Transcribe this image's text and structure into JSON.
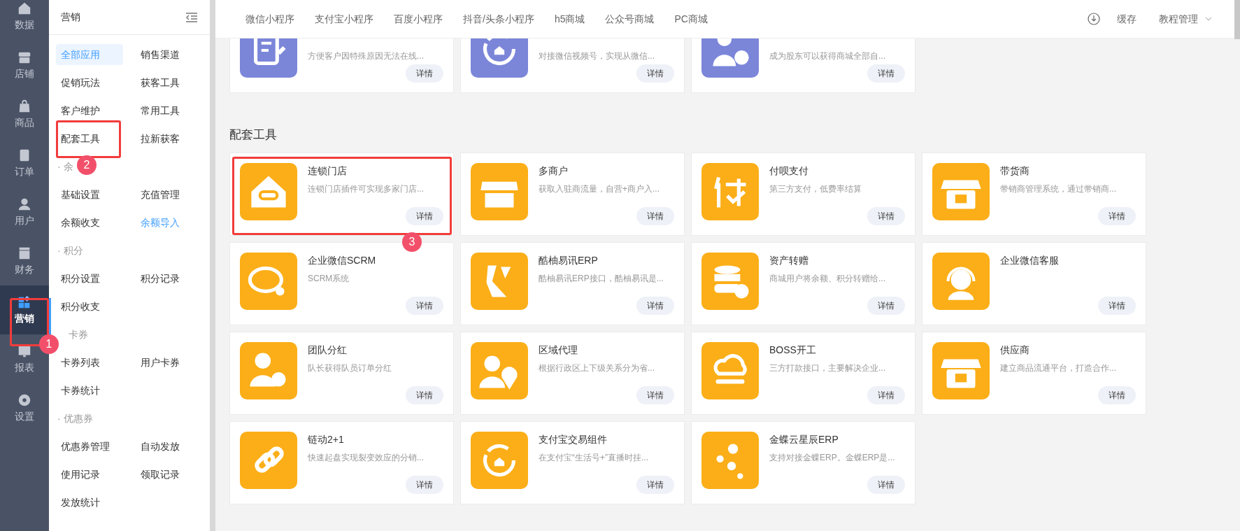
{
  "rail": [
    {
      "label": "数据",
      "selected": false
    },
    {
      "label": "店铺",
      "selected": false
    },
    {
      "label": "商品",
      "selected": false
    },
    {
      "label": "订单",
      "selected": false
    },
    {
      "label": "用户",
      "selected": false
    },
    {
      "label": "财务",
      "selected": false
    },
    {
      "label": "营销",
      "selected": true
    },
    {
      "label": "报表",
      "selected": false
    },
    {
      "label": "设置",
      "selected": false
    }
  ],
  "submenu": {
    "title": "营销",
    "groups": [
      {
        "items": [
          {
            "label": "全部应用",
            "kind": "normal",
            "selected": true
          },
          {
            "label": "销售渠道",
            "kind": "normal",
            "selected": false
          },
          {
            "label": "促销玩法",
            "kind": "normal",
            "selected": false
          },
          {
            "label": "获客工具",
            "kind": "normal",
            "selected": false
          },
          {
            "label": "客户维护",
            "kind": "normal",
            "selected": false
          },
          {
            "label": "常用工具",
            "kind": "normal",
            "selected": false
          },
          {
            "label": "配套工具",
            "kind": "normal",
            "selected": false
          },
          {
            "label": "拉新获客",
            "kind": "normal",
            "selected": false
          }
        ]
      },
      {
        "heading": "· 余",
        "items": [
          {
            "label": "基础设置",
            "kind": "normal",
            "selected": false
          },
          {
            "label": "充值管理",
            "kind": "normal",
            "selected": false
          },
          {
            "label": "余额收支",
            "kind": "normal",
            "selected": false
          },
          {
            "label": "余额导入",
            "kind": "link",
            "selected": false
          }
        ]
      },
      {
        "heading": "· 积分",
        "items": [
          {
            "label": "积分设置",
            "kind": "normal",
            "selected": false
          },
          {
            "label": "积分记录",
            "kind": "normal",
            "selected": false
          },
          {
            "label": "积分收支",
            "kind": "normal",
            "selected": false
          }
        ]
      },
      {
        "heading": "卡券",
        "items": [
          {
            "label": "卡券列表",
            "kind": "normal",
            "selected": false
          },
          {
            "label": "用户卡券",
            "kind": "normal",
            "selected": false
          },
          {
            "label": "卡券统计",
            "kind": "normal",
            "selected": false
          }
        ]
      },
      {
        "heading": "· 优惠券",
        "items": [
          {
            "label": "优惠券管理",
            "kind": "normal",
            "selected": false
          },
          {
            "label": "自动发放",
            "kind": "normal",
            "selected": false
          },
          {
            "label": "使用记录",
            "kind": "normal",
            "selected": false
          },
          {
            "label": "领取记录",
            "kind": "normal",
            "selected": false
          },
          {
            "label": "发放统计",
            "kind": "normal",
            "selected": false
          }
        ]
      }
    ]
  },
  "top_nav": {
    "tabs": [
      "微信小程序",
      "支付宝小程序",
      "百度小程序",
      "抖音/头条小程序",
      "h5商城",
      "公众号商城",
      "PC商城"
    ],
    "cache": "缓存",
    "tutorial": "教程管理"
  },
  "top_cards": [
    {
      "desc": "方便客户因特殊原因无法在线...",
      "button": "详情",
      "color": "#7b86d9"
    },
    {
      "desc": "对接微信视频号，实现从微信...",
      "button": "详情",
      "color": "#7b86d9"
    },
    {
      "desc": "成为股东可以获得商城全部自...",
      "button": "详情",
      "color": "#7b86d9"
    }
  ],
  "section": {
    "title": "配套工具",
    "cards": [
      {
        "title": "连锁门店",
        "desc": "连锁门店插件可实现多家门店...",
        "button": "详情",
        "color": "#fbae17"
      },
      {
        "title": "多商户",
        "desc": "获取入驻商流量，自营+商户入...",
        "button": "详情",
        "color": "#fbae17"
      },
      {
        "title": "付呗支付",
        "desc": "第三方支付，低费率结算",
        "button": "详情",
        "color": "#fbae17"
      },
      {
        "title": "带货商",
        "desc": "带销商管理系统，通过带销商...",
        "button": "详情",
        "color": "#fbae17"
      },
      {
        "title": "企业微信SCRM",
        "desc": "SCRM系统",
        "button": "详情",
        "color": "#fbae17"
      },
      {
        "title": "酷柚易讯ERP",
        "desc": "酷柚易讯ERP接口，酷柚易讯是...",
        "button": "详情",
        "color": "#fbae17"
      },
      {
        "title": "资产转赠",
        "desc": "商城用户将余额、积分转赠给...",
        "button": "详情",
        "color": "#fbae17"
      },
      {
        "title": "企业微信客服",
        "button": "详情",
        "color": "#fbae17"
      },
      {
        "title": "团队分红",
        "desc": "队长获得队员订单分红",
        "button": "详情",
        "color": "#fbae17"
      },
      {
        "title": "区域代理",
        "desc": "根据行政区上下级关系分为省...",
        "button": "详情",
        "color": "#fbae17"
      },
      {
        "title": "BOSS开工",
        "desc": "三方打款接口，主要解决企业...",
        "button": "详情",
        "color": "#fbae17"
      },
      {
        "title": "供应商",
        "desc": "建立商品流通平台，打造合作...",
        "button": "详情",
        "color": "#fbae17"
      },
      {
        "title": "链动2+1",
        "desc": "快速起盘实现裂变效应的分销...",
        "button": "详情",
        "color": "#fbae17"
      },
      {
        "title": "支付宝交易组件",
        "desc": "在支付宝“生活号+”直播时挂...",
        "button": "详情",
        "color": "#fbae17"
      },
      {
        "title": "金蝶云星辰ERP",
        "desc": "支持对接金蝶ERP。金蝶ERP是...",
        "button": "详情",
        "color": "#fbae17"
      }
    ]
  },
  "annotations": [
    "1",
    "2",
    "3"
  ]
}
